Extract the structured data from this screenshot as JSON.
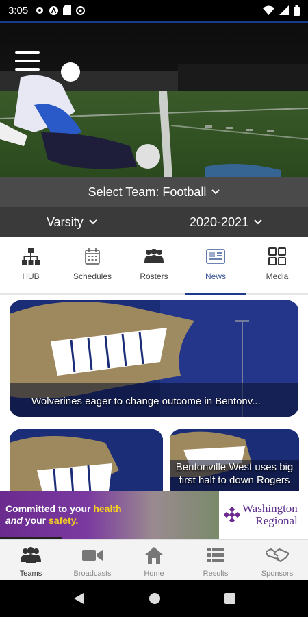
{
  "status_bar": {
    "time": "3:05",
    "left_icons": [
      "gear-icon",
      "app-a-icon",
      "sd-card-icon",
      "sync-icon"
    ],
    "right_icons": [
      "wifi-icon",
      "signal-icon",
      "battery-icon"
    ]
  },
  "header": {
    "menu_icon": "hamburger-menu-icon"
  },
  "team_selector": {
    "label": "Select Team:",
    "team": "Football"
  },
  "filters": {
    "level": "Varsity",
    "season": "2020-2021"
  },
  "tabs": [
    {
      "label": "HUB",
      "icon": "hierarchy-icon"
    },
    {
      "label": "Schedules",
      "icon": "calendar-icon"
    },
    {
      "label": "Rosters",
      "icon": "people-icon"
    },
    {
      "label": "News",
      "icon": "newspaper-icon",
      "active": true
    },
    {
      "label": "Media",
      "icon": "grid-icon"
    }
  ],
  "news": [
    {
      "headline": "Wolverines eager to change outcome in Bentonv..."
    },
    {
      "headline": ""
    },
    {
      "headline": "Bentonville West uses big first half to down Rogers"
    }
  ],
  "ad": {
    "line1_a": "Committed to your ",
    "line1_b": "health",
    "line2_a": "and",
    "line2_b": " your ",
    "line2_c": "safety.",
    "brand_line1": "Washington",
    "brand_line2": "Regional",
    "progress": 0.2,
    "colors": {
      "purple": "#6a2a8e",
      "highlight": "#f5d020"
    }
  },
  "bottom_nav": [
    {
      "label": "Teams",
      "icon": "team-icon",
      "active": true
    },
    {
      "label": "Broadcasts",
      "icon": "video-camera-icon"
    },
    {
      "label": "Home",
      "icon": "home-icon"
    },
    {
      "label": "Results",
      "icon": "list-icon"
    },
    {
      "label": "Sponsors",
      "icon": "handshake-icon"
    }
  ],
  "system_nav": [
    "back-icon",
    "home-circle-icon",
    "recents-icon"
  ],
  "colors": {
    "accent": "#1e3a8c",
    "active_tab": "#3d5a99",
    "team_bar": "#4a4a4a",
    "level_bar": "#3a3a3a"
  }
}
